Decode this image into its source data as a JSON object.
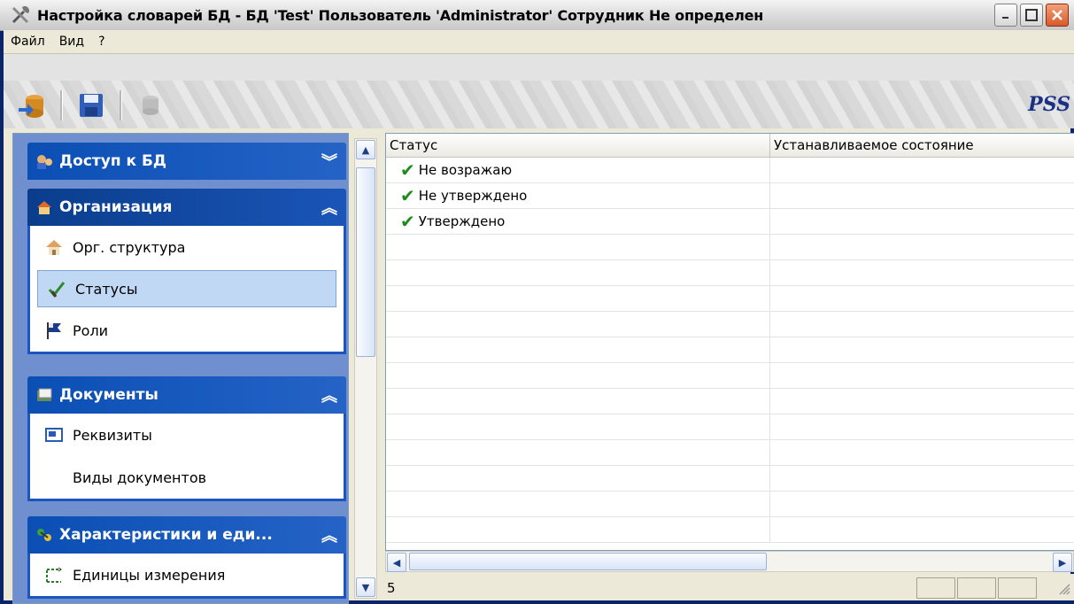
{
  "window": {
    "title": "Настройка словарей БД - БД 'Test' Пользователь 'Administrator' Сотрудник Не определен"
  },
  "menu": [
    "Файл",
    "Вид",
    "?"
  ],
  "toolbar": {
    "buttons": [
      "connect-db-icon",
      "save-icon",
      "disabled-action-icon"
    ],
    "brand": "PSS"
  },
  "sidebar": {
    "groups": [
      {
        "title": "Доступ к БД",
        "icon": "db-access-icon",
        "expanded": false,
        "items": []
      },
      {
        "title": "Организация",
        "icon": "organization-icon",
        "expanded": true,
        "items": [
          {
            "label": "Орг. структура",
            "icon": "house-icon"
          },
          {
            "label": "Статусы",
            "icon": "status-check-icon",
            "active": true
          },
          {
            "label": "Роли",
            "icon": "flag-icon"
          }
        ]
      },
      {
        "title": "Документы",
        "icon": "documents-icon",
        "expanded": true,
        "items": [
          {
            "label": "Реквизиты",
            "icon": "field-icon"
          },
          {
            "label": "Виды документов",
            "icon": ""
          }
        ]
      },
      {
        "title": "Характеристики и еди...",
        "icon": "characteristics-icon",
        "expanded": true,
        "items": [
          {
            "label": "Единицы измерения",
            "icon": "measure-icon"
          }
        ]
      }
    ]
  },
  "grid": {
    "columns": [
      "Статус",
      "Устанавливаемое состояние"
    ],
    "rows": [
      {
        "status": "Не возражаю",
        "state": ""
      },
      {
        "status": "Не утверждено",
        "state": ""
      },
      {
        "status": "Утверждено",
        "state": ""
      }
    ]
  },
  "statusbar": {
    "count": "5"
  },
  "colors": {
    "accent": "#0b4fb4",
    "check": "#1b8c1b",
    "brand": "#1a2f86"
  }
}
